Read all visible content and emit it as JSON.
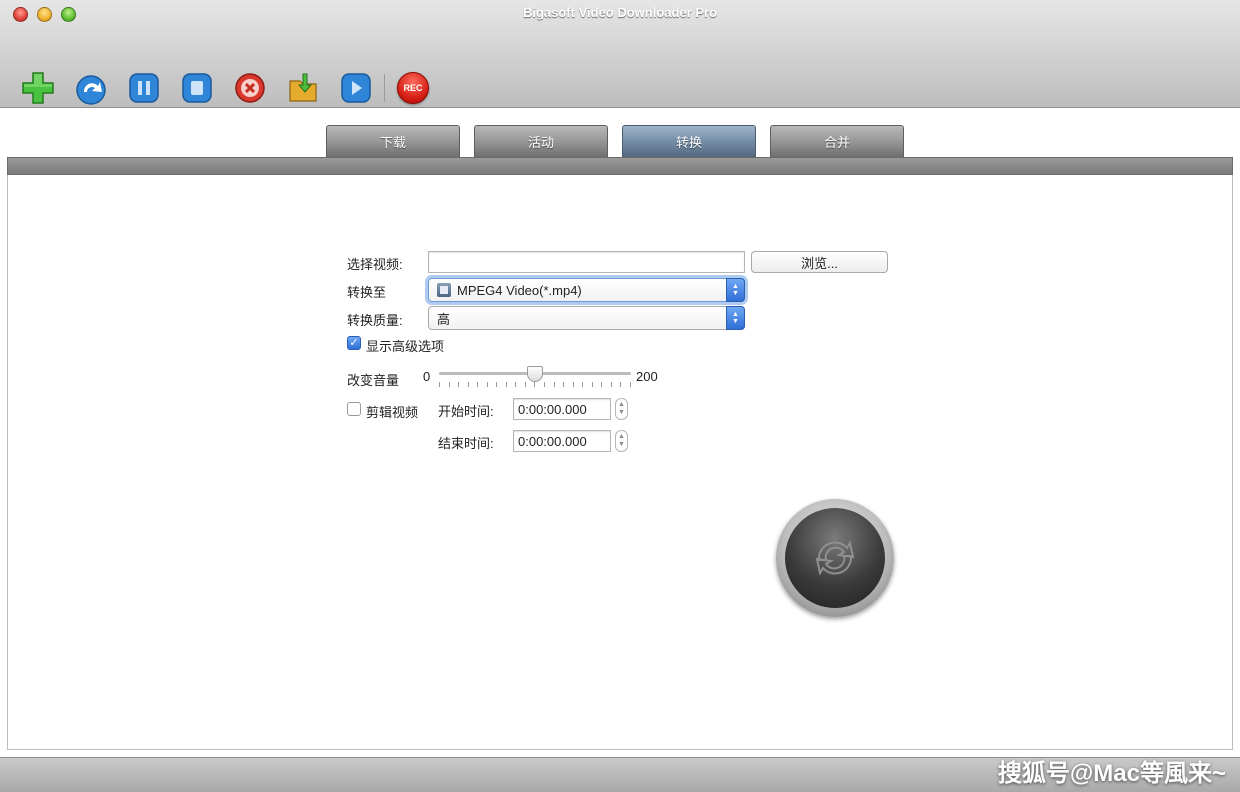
{
  "window": {
    "title": "Bigasoft Video Downloader Pro"
  },
  "toolbar": {
    "buttons": [
      {
        "name": "add-icon",
        "color": "#3fb73a"
      },
      {
        "name": "refresh-icon",
        "color": "#2a7fd1"
      },
      {
        "name": "pause-icon",
        "color": "#2a7fd1"
      },
      {
        "name": "stop-icon",
        "color": "#2a7fd1"
      },
      {
        "name": "delete-icon",
        "color": "#d83a2e"
      },
      {
        "name": "folder-icon",
        "color": "#e0a52a"
      },
      {
        "name": "play-icon",
        "color": "#2a7fd1"
      }
    ],
    "rec_label": "REC"
  },
  "tabs": [
    {
      "label": "下载",
      "active": false
    },
    {
      "label": "活动",
      "active": false
    },
    {
      "label": "转换",
      "active": true
    },
    {
      "label": "合并",
      "active": false
    }
  ],
  "form": {
    "select_video_label": "选择视频:",
    "select_video_value": "",
    "browse_label": "浏览...",
    "convert_to_label": "转换至",
    "convert_to_value": "MPEG4 Video(*.mp4)",
    "quality_label": "转换质量:",
    "quality_value": "高",
    "show_advanced_label": "显示高级选项",
    "show_advanced_checked": true,
    "volume_label": "改变音量",
    "volume_min": "0",
    "volume_max": "200",
    "volume_value": 100,
    "trim_label": "剪辑视频",
    "trim_checked": false,
    "start_time_label": "开始时间:",
    "start_time_value": "0:00:00.000",
    "end_time_label": "结束时间:",
    "end_time_value": "0:00:00.000"
  },
  "watermark": "搜狐号@Mac等風来~"
}
